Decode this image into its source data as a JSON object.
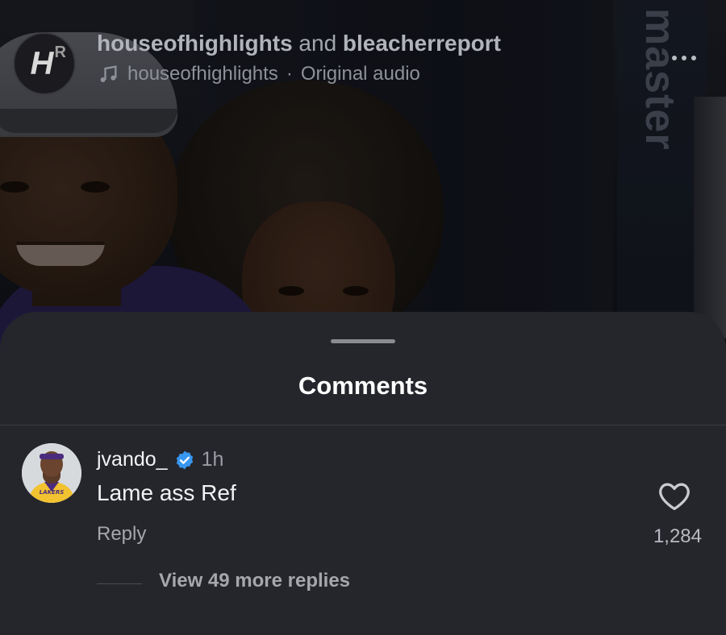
{
  "post": {
    "author_primary": "houseofhighlights",
    "author_connector": "and",
    "author_secondary": "bleacherreport",
    "audio_account": "houseofhighlights",
    "audio_separator": "·",
    "audio_label": "Original audio",
    "logo_text_main": "H",
    "logo_text_sub": "R",
    "video_banner_text": "master",
    "icons": {
      "music": "music-note-icon",
      "more": "more-horizontal-icon"
    }
  },
  "comments_sheet": {
    "title": "Comments",
    "comment": {
      "username": "jvando_",
      "verified": true,
      "time": "1h",
      "text": "Lame ass Ref",
      "reply_label": "Reply",
      "like_count": "1,284",
      "view_replies_label": "View 49 more replies",
      "avatar_jersey_text": "LAKERS",
      "icons": {
        "verified": "verified-badge-icon",
        "like": "heart-icon"
      }
    }
  },
  "colors": {
    "sheet_bg": "#25262b",
    "verified_blue": "#3897f0",
    "text_primary": "#f1f2f4",
    "text_secondary": "#a5a7ad"
  }
}
